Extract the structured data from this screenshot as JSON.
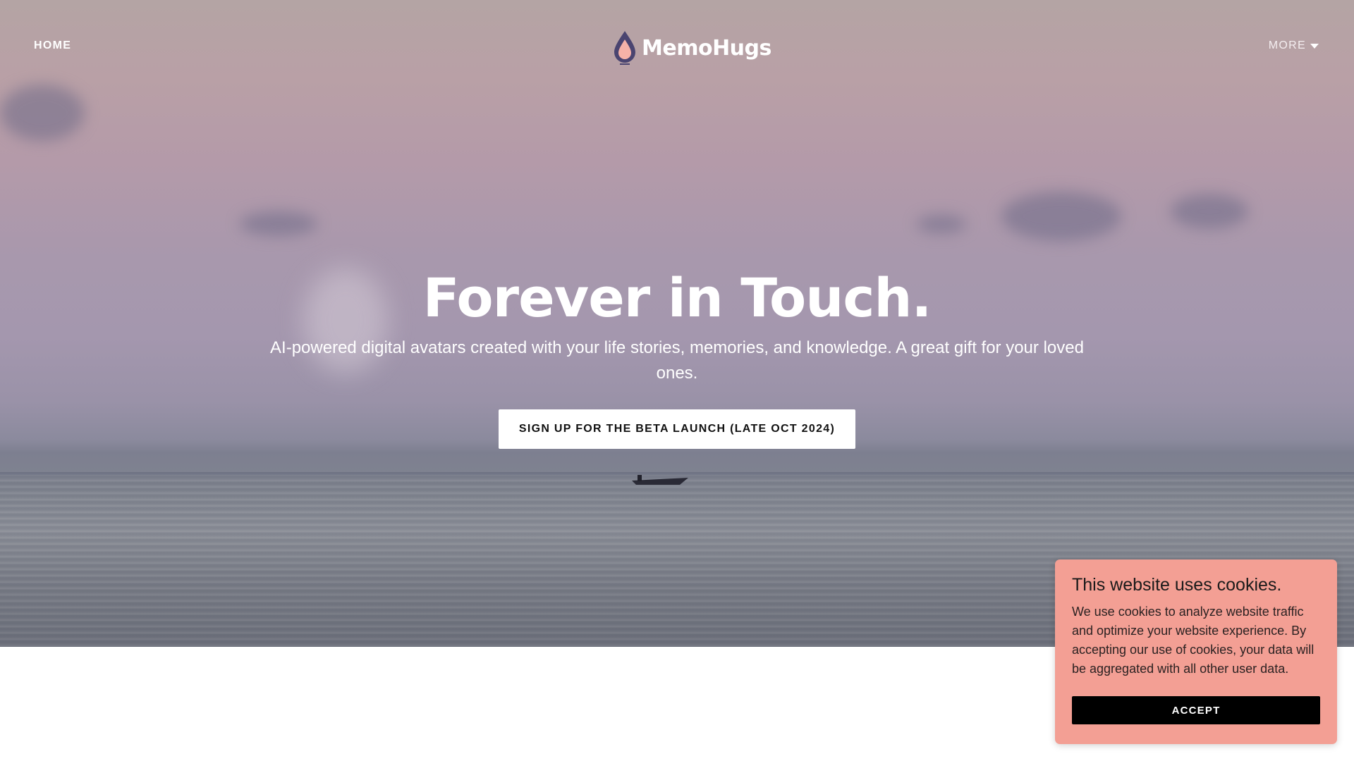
{
  "nav": {
    "home_label": "HOME",
    "more_label": "MORE",
    "more_icon": "caret-down-icon"
  },
  "logo": {
    "text": "MemoHugs",
    "icon": "water-drop-icon"
  },
  "hero": {
    "title": "Forever in Touch.",
    "subtitle": "AI-powered digital avatars created with your life stories, memories, and knowledge. A great gift for your loved ones.",
    "cta_label": "SIGN UP FOR THE BETA LAUNCH (LATE OCT 2024)"
  },
  "cookie_banner": {
    "title": "This website uses cookies.",
    "body": "We use cookies to analyze website traffic and optimize your website experience. By accepting our use of cookies, your data will be aggregated with all other user data.",
    "accept_label": "ACCEPT",
    "background_color": "#f39f94"
  }
}
